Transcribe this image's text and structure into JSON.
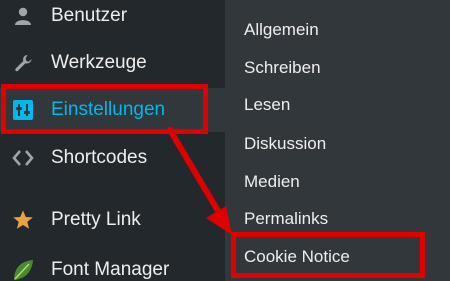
{
  "sidebar": {
    "items": [
      {
        "label": "Benutzer",
        "icon": "user-icon"
      },
      {
        "label": "Werkzeuge",
        "icon": "wrench-icon"
      },
      {
        "label": "Einstellungen",
        "icon": "settings-sliders-icon",
        "active": true
      },
      {
        "label": "Shortcodes",
        "icon": "code-brackets-icon"
      },
      {
        "label": "Pretty Link",
        "icon": "star-icon"
      },
      {
        "label": "Font Manager",
        "icon": "leaf-icon"
      }
    ]
  },
  "submenu": {
    "items": [
      {
        "label": "Allgemein"
      },
      {
        "label": "Schreiben"
      },
      {
        "label": "Lesen"
      },
      {
        "label": "Diskussion"
      },
      {
        "label": "Medien"
      },
      {
        "label": "Permalinks"
      },
      {
        "label": "Cookie Notice"
      }
    ]
  },
  "colors": {
    "sidebar_bg": "#23282d",
    "submenu_bg": "#32373c",
    "active_text": "#00b9eb",
    "highlight": "#e00000",
    "star": "#e8a33d",
    "leaf": "#4c8a2e"
  }
}
